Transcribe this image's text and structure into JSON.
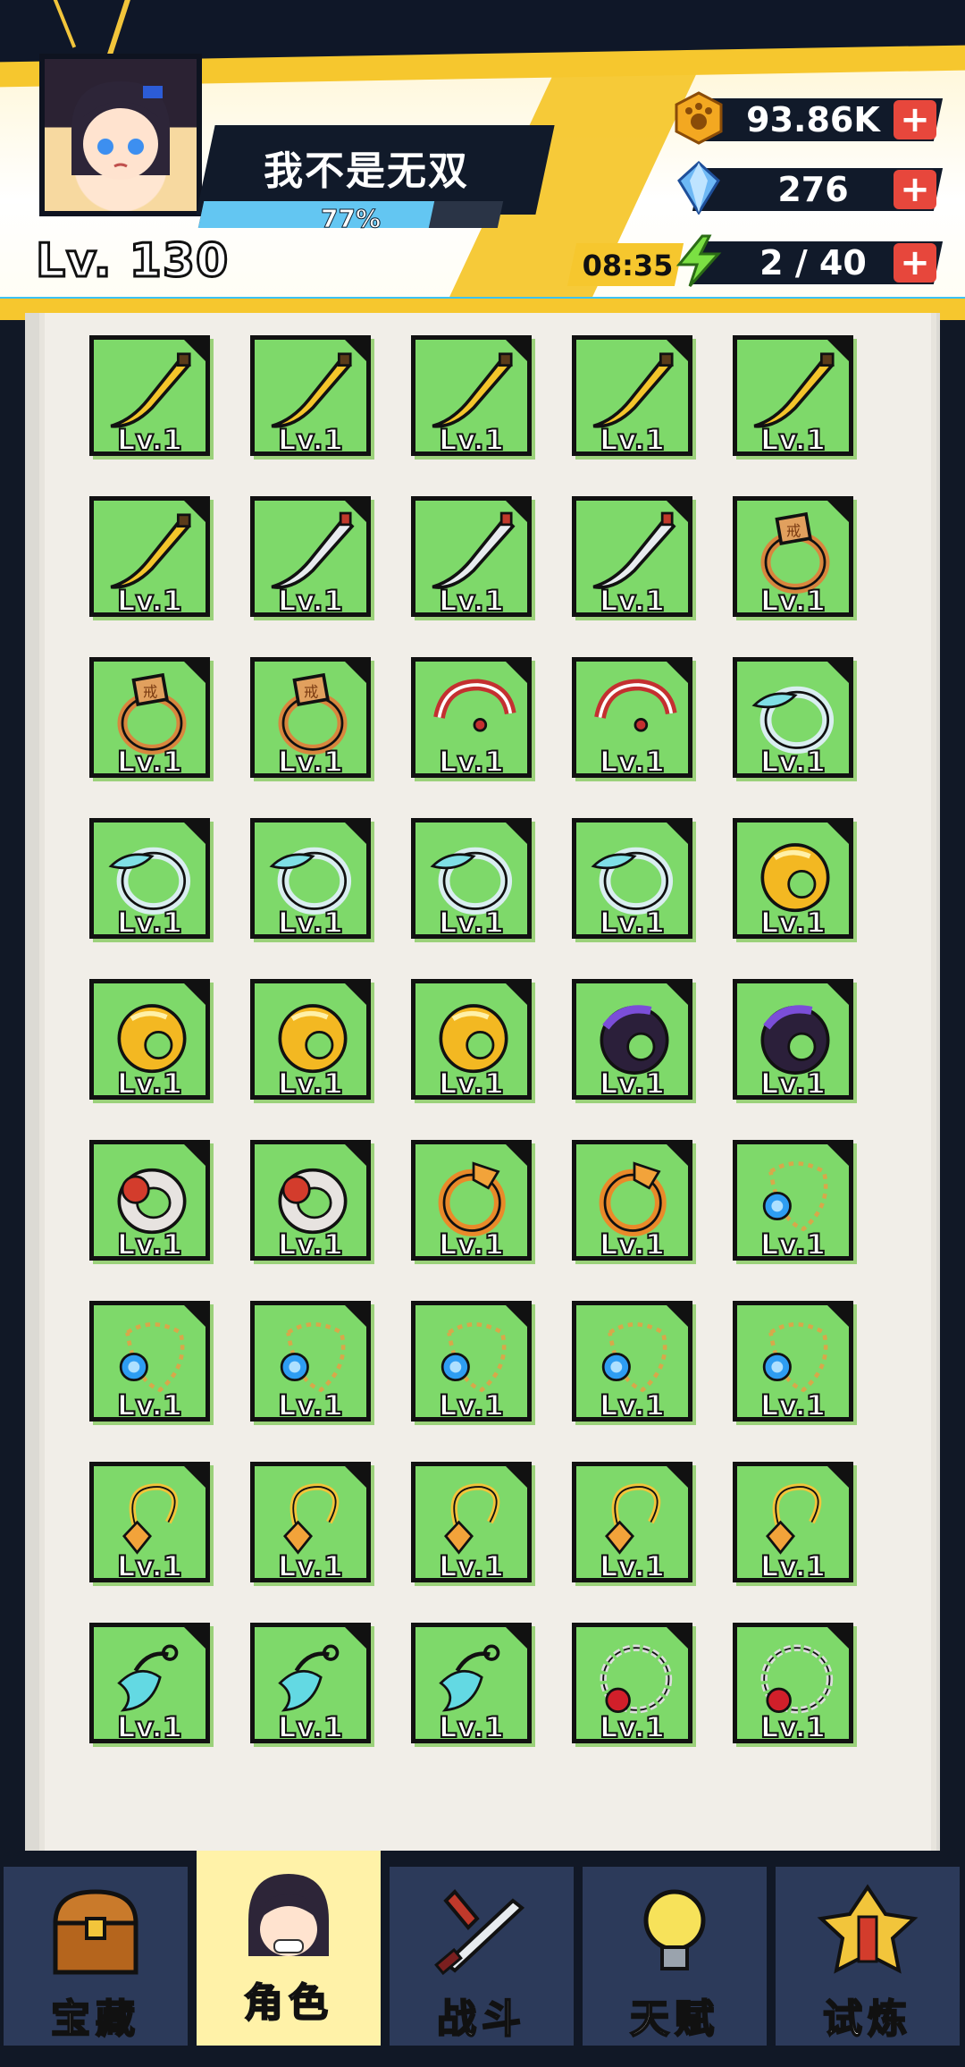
{
  "header": {
    "player_name": "我不是无双",
    "level": "Lv. 130",
    "exp_percent_text": "77%",
    "exp_fraction": 0.77,
    "timer": "08:35"
  },
  "resources": [
    {
      "icon": "paw-coin-icon",
      "value": "93.86K"
    },
    {
      "icon": "diamond-gem-icon",
      "value": "276"
    },
    {
      "icon": "lightning-energy-icon",
      "value": "2 / 40"
    }
  ],
  "plus_label": "+",
  "items": [
    {
      "icon": "banana-blade-icon",
      "level": "Lv.1"
    },
    {
      "icon": "banana-blade-icon",
      "level": "Lv.1"
    },
    {
      "icon": "banana-blade-icon",
      "level": "Lv.1"
    },
    {
      "icon": "banana-blade-icon",
      "level": "Lv.1"
    },
    {
      "icon": "banana-blade-icon",
      "level": "Lv.1"
    },
    {
      "icon": "banana-blade-icon",
      "level": "Lv.1"
    },
    {
      "icon": "silver-blade-icon",
      "level": "Lv.1"
    },
    {
      "icon": "silver-blade-icon",
      "level": "Lv.1"
    },
    {
      "icon": "silver-blade-icon",
      "level": "Lv.1"
    },
    {
      "icon": "bronze-seal-ring-icon",
      "level": "Lv.1"
    },
    {
      "icon": "bronze-seal-ring-icon",
      "level": "Lv.1"
    },
    {
      "icon": "bronze-seal-ring-icon",
      "level": "Lv.1"
    },
    {
      "icon": "red-pearl-ring-icon",
      "level": "Lv.1"
    },
    {
      "icon": "red-pearl-ring-icon",
      "level": "Lv.1"
    },
    {
      "icon": "jade-ring-icon",
      "level": "Lv.1"
    },
    {
      "icon": "jade-ring-icon",
      "level": "Lv.1"
    },
    {
      "icon": "jade-ring-icon",
      "level": "Lv.1"
    },
    {
      "icon": "jade-ring-icon",
      "level": "Lv.1"
    },
    {
      "icon": "jade-ring-icon",
      "level": "Lv.1"
    },
    {
      "icon": "gold-ring-icon",
      "level": "Lv.1"
    },
    {
      "icon": "gold-ring-icon",
      "level": "Lv.1"
    },
    {
      "icon": "gold-ring-icon",
      "level": "Lv.1"
    },
    {
      "icon": "gold-ring-icon",
      "level": "Lv.1"
    },
    {
      "icon": "purple-ring-icon",
      "level": "Lv.1"
    },
    {
      "icon": "purple-ring-icon",
      "level": "Lv.1"
    },
    {
      "icon": "red-seal-ring-icon",
      "level": "Lv.1"
    },
    {
      "icon": "red-seal-ring-icon",
      "level": "Lv.1"
    },
    {
      "icon": "dragon-ring-icon",
      "level": "Lv.1"
    },
    {
      "icon": "dragon-ring-icon",
      "level": "Lv.1"
    },
    {
      "icon": "sapphire-necklace-icon",
      "level": "Lv.1"
    },
    {
      "icon": "sapphire-necklace-icon",
      "level": "Lv.1"
    },
    {
      "icon": "sapphire-necklace-icon",
      "level": "Lv.1"
    },
    {
      "icon": "sapphire-necklace-icon",
      "level": "Lv.1"
    },
    {
      "icon": "sapphire-necklace-icon",
      "level": "Lv.1"
    },
    {
      "icon": "sapphire-necklace-icon",
      "level": "Lv.1"
    },
    {
      "icon": "gold-pendant-icon",
      "level": "Lv.1"
    },
    {
      "icon": "gold-pendant-icon",
      "level": "Lv.1"
    },
    {
      "icon": "gold-pendant-icon",
      "level": "Lv.1"
    },
    {
      "icon": "gold-pendant-icon",
      "level": "Lv.1"
    },
    {
      "icon": "gold-pendant-icon",
      "level": "Lv.1"
    },
    {
      "icon": "jade-pendant-icon",
      "level": "Lv.1"
    },
    {
      "icon": "jade-pendant-icon",
      "level": "Lv.1"
    },
    {
      "icon": "jade-pendant-icon",
      "level": "Lv.1"
    },
    {
      "icon": "ruby-bead-necklace-icon",
      "level": "Lv.1"
    },
    {
      "icon": "ruby-bead-necklace-icon",
      "level": "Lv.1"
    }
  ],
  "nav": [
    {
      "icon": "treasure-chest-icon",
      "label": "宝藏",
      "active": false
    },
    {
      "icon": "character-portrait-icon",
      "label": "角色",
      "active": true
    },
    {
      "icon": "crossed-swords-icon",
      "label": "战斗",
      "active": false
    },
    {
      "icon": "lightbulb-icon",
      "label": "天赋",
      "active": false
    },
    {
      "icon": "trophy-emblem-icon",
      "label": "试炼",
      "active": false
    }
  ],
  "colors": {
    "tile_green": "#7ed96a",
    "header_yellow": "#f6c72e",
    "exp_blue": "#63c6f2",
    "plus_red": "#e7473c",
    "nav_blue": "#2c3a5a"
  }
}
